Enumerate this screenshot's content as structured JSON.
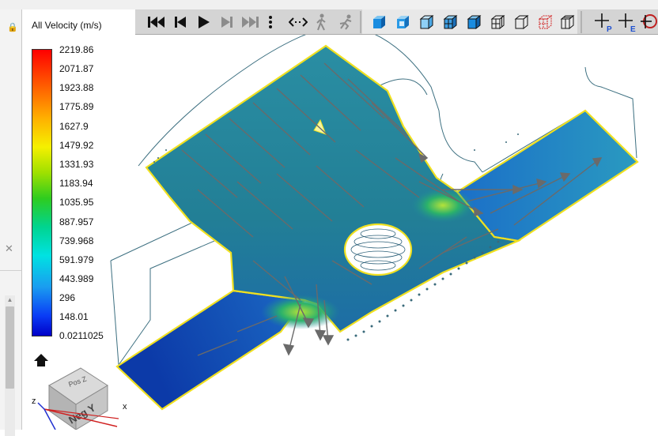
{
  "legend": {
    "title": "All Velocity (m/s)",
    "ticks": [
      "2219.86",
      "2071.87",
      "1923.88",
      "1775.89",
      "1627.9",
      "1479.92",
      "1331.93",
      "1183.94",
      "1035.95",
      "887.957",
      "739.968",
      "591.979",
      "443.989",
      "296",
      "148.01",
      "0.0211025"
    ]
  },
  "orientation_cube": {
    "face_front": "Neg Y",
    "face_top": "Pos Z",
    "axis_z": "z",
    "axis_x": "x"
  },
  "toolbar": {
    "tools": [
      {
        "id": "first-frame",
        "icon": "skip-first-icon"
      },
      {
        "id": "prev-frame",
        "icon": "step-back-icon"
      },
      {
        "id": "play",
        "icon": "play-icon"
      },
      {
        "id": "next-frame",
        "icon": "step-forward-icon"
      },
      {
        "id": "last-frame",
        "icon": "skip-last-icon"
      },
      {
        "id": "more",
        "icon": "vertical-ellipsis-icon"
      },
      {
        "id": "bounce",
        "icon": "bounce-arrows-icon"
      },
      {
        "id": "walk",
        "icon": "walk-icon"
      },
      {
        "id": "run",
        "icon": "run-icon"
      },
      {
        "id": "shaded-smooth",
        "icon": "shaded-view-icon"
      },
      {
        "id": "shaded-edges",
        "icon": "shaded-edges-icon"
      },
      {
        "id": "shaded-box",
        "icon": "shaded-box-icon"
      },
      {
        "id": "shaded-mesh",
        "icon": "shaded-mesh-icon"
      },
      {
        "id": "solid-box",
        "icon": "solid-box-icon"
      },
      {
        "id": "wire-mesh",
        "icon": "wireframe-mesh-icon"
      },
      {
        "id": "wire-box",
        "icon": "wireframe-box-icon"
      },
      {
        "id": "wire-red",
        "icon": "wireframe-red-icon"
      },
      {
        "id": "wire-hidden",
        "icon": "wireframe-hidden-icon"
      },
      {
        "id": "probe-p",
        "icon": "probe-p-icon",
        "label": "P"
      },
      {
        "id": "probe-e",
        "icon": "probe-e-icon",
        "label": "E"
      },
      {
        "id": "probe-extra",
        "icon": "probe-extra-icon"
      }
    ]
  },
  "colors": {
    "model_fill": "#1f7f96",
    "boundary": "#f0e020",
    "arrow": "#6c6c6c",
    "outline": "#3c6f80"
  }
}
